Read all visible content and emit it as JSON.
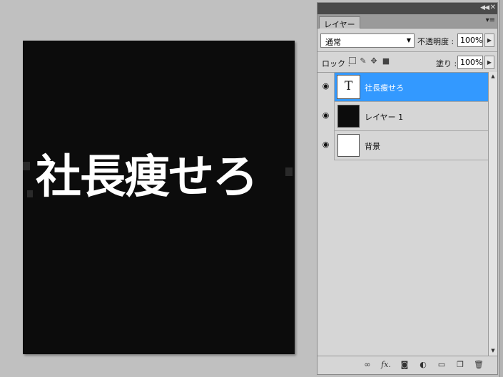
{
  "canvas": {
    "text": "社長痩せろ"
  },
  "panel": {
    "tab_label": "レイヤー",
    "collapse_icon": "collapse-icon",
    "close_icon": "close-icon",
    "blend_mode": "通常",
    "opacity_label": "不透明度 :",
    "opacity_value": "100%",
    "lock_label": "ロック :",
    "fill_label": "塗り :",
    "fill_value": "100%",
    "layers": [
      {
        "name": "社長痩せろ",
        "thumb": "T",
        "selected": true
      },
      {
        "name": "レイヤー 1",
        "thumb": "",
        "selected": false
      },
      {
        "name": "背景",
        "thumb": "",
        "selected": false
      }
    ],
    "bottom_icons": [
      "link-icon",
      "fx-icon",
      "mask-icon",
      "adjustment-icon",
      "folder-icon",
      "new-layer-icon",
      "trash-icon"
    ],
    "fx_label": "fx."
  },
  "colors": {
    "selection": "#3399ff",
    "canvas": "#0c0c0c",
    "panel": "#d6d6d6"
  }
}
